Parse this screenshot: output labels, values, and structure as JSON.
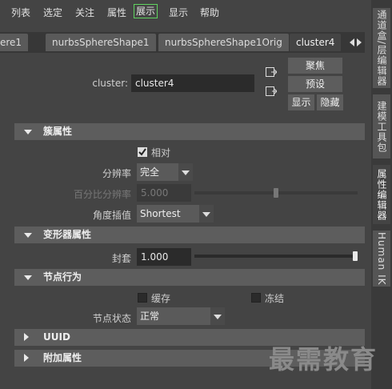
{
  "menu": [
    "列表",
    "选定",
    "关注",
    "属性",
    "展示",
    "显示",
    "帮助"
  ],
  "tabs": [
    "ere1",
    "nurbsSphereShape1",
    "nurbsSphereShape1Orig",
    "cluster4"
  ],
  "side_tabs": [
    "通道盒/层编辑器",
    "建模工具包",
    "属性编辑器",
    "Human IK"
  ],
  "node": {
    "label": "cluster:",
    "value": "cluster4"
  },
  "buttons": {
    "focus": "聚焦",
    "preset": "预设",
    "show": "显示",
    "hide": "隐藏"
  },
  "sections": {
    "cluster_attrs": "簇属性",
    "deformer_attrs": "变形器属性",
    "node_behavior": "节点行为",
    "uuid": "UUID",
    "extra_attrs": "附加属性"
  },
  "cluster": {
    "relative_label": "相对",
    "relative_checked": true,
    "resolution_label": "分辨率",
    "resolution_value": "完全",
    "percent_label": "百分比分辨率",
    "percent_value": "5.000",
    "percent_fraction": 0.5,
    "angle_label": "角度插值",
    "angle_value": "Shortest"
  },
  "deformer": {
    "envelope_label": "封套",
    "envelope_value": "1.000",
    "envelope_fraction": 1.0
  },
  "behavior": {
    "caching_label": "缓存",
    "caching_checked": false,
    "frozen_label": "冻结",
    "frozen_checked": false,
    "node_state_label": "节点状态",
    "node_state_value": "正常"
  },
  "watermark": "最需教育",
  "colors": {
    "active_menu_border": "#5fd35f",
    "panel_bg": "#444444",
    "section_bg": "#5d5d5d"
  }
}
